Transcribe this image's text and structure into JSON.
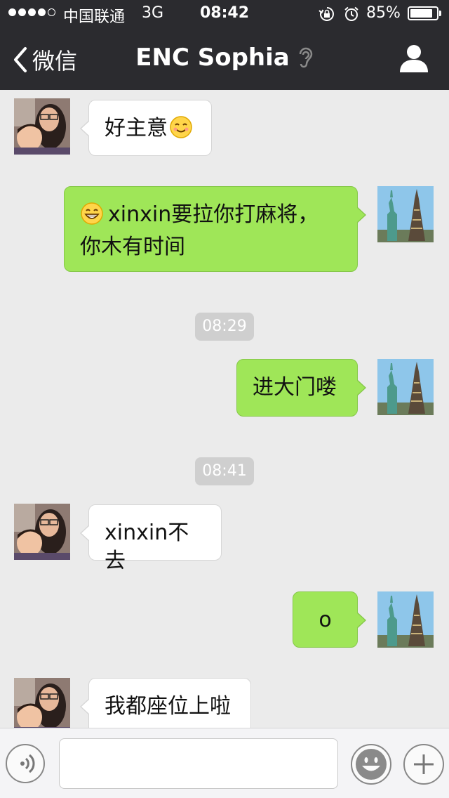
{
  "status_bar": {
    "carrier": "中国联通",
    "network": "3G",
    "time": "08:42",
    "battery_percent": "85%",
    "battery_level": 0.85,
    "signal_bars": 4,
    "icons": [
      "signal-dots-icon",
      "rotation-lock-icon",
      "alarm-icon",
      "battery-icon"
    ]
  },
  "nav_bar": {
    "back_label": "微信",
    "title": "ENC Sophia",
    "icons": [
      "chevron-left-icon",
      "ear-icon",
      "person-icon"
    ]
  },
  "messages": [
    {
      "side": "left",
      "text": "好主意",
      "emoji_after": "smile-emoji"
    },
    {
      "side": "right",
      "emoji_before": "grin-emoji",
      "text_line1": "xinxin要拉你打麻将，",
      "text_line2": "你木有时间"
    },
    {
      "type": "timestamp",
      "text": "08:29"
    },
    {
      "side": "right",
      "text": "进大门喽"
    },
    {
      "type": "timestamp",
      "text": "08:41"
    },
    {
      "side": "left",
      "text": "xinxin不去"
    },
    {
      "side": "right",
      "text": "o"
    },
    {
      "side": "left",
      "text": "我都座位上啦"
    }
  ],
  "input_bar": {
    "value": "",
    "icons": [
      "voice-icon",
      "emoji-icon",
      "plus-icon"
    ]
  },
  "colors": {
    "nav_background": "#2b2b2f",
    "chat_background": "#ebebeb",
    "outgoing_bubble": "#9fe658",
    "incoming_bubble": "#ffffff",
    "timestamp_chip": "#cfcfcf"
  }
}
